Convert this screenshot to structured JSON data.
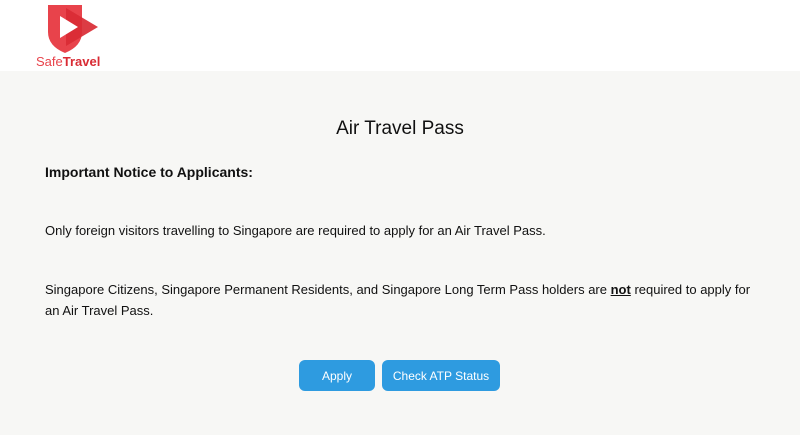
{
  "brand": {
    "logo_part1": "Safe",
    "logo_part2": "Travel",
    "colors": {
      "primary": "#e8434b",
      "dark": "#d92b34"
    }
  },
  "main": {
    "title": "Air Travel Pass",
    "notice_heading": "Important Notice to Applicants:",
    "paragraph1": "Only foreign visitors travelling to Singapore are required to apply for an Air Travel Pass.",
    "paragraph2_before": "Singapore Citizens, Singapore Permanent Residents, and Singapore Long Term Pass holders are ",
    "paragraph2_emphasis": "not",
    "paragraph2_after": " required to apply for an Air Travel Pass.",
    "background": "#f7f7f5"
  },
  "actions": {
    "apply_label": "Apply",
    "check_status_label": "Check ATP Status",
    "button_color": "#2e9be0"
  }
}
